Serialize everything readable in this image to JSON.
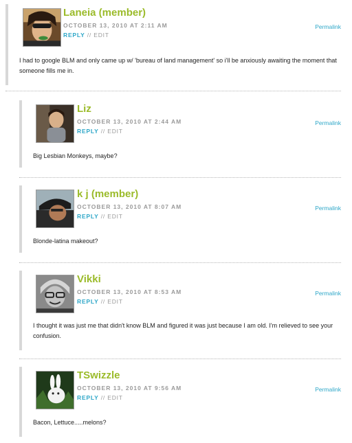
{
  "comments": [
    {
      "author": "Laneia (member)",
      "date": "OCTOBER 13, 2010 AT 2:11 AM",
      "reply": "REPLY",
      "divider": " // ",
      "edit": "EDIT",
      "permalink": "Permalink",
      "text": "I had to google BLM and only came up w/ 'bureau of land management' so i'll be anxiously awaiting the moment that someone fills me in."
    },
    {
      "author": "Liz",
      "date": "OCTOBER 13, 2010 AT 2:44 AM",
      "reply": "REPLY",
      "divider": " // ",
      "edit": "EDIT",
      "permalink": "Permalink",
      "text": "Big Lesbian Monkeys, maybe?"
    },
    {
      "author": "k j (member)",
      "date": "OCTOBER 13, 2010 AT 8:07 AM",
      "reply": "REPLY",
      "divider": " // ",
      "edit": "EDIT",
      "permalink": "Permalink",
      "text": "Blonde-latina makeout?"
    },
    {
      "author": "Vikki",
      "date": "OCTOBER 13, 2010 AT 8:53 AM",
      "reply": "REPLY",
      "divider": " // ",
      "edit": "EDIT",
      "permalink": "Permalink",
      "text": "I thought it was just me that didn't know BLM and figured it was just because I am old. I'm relieved to see your confusion."
    },
    {
      "author": "TSwizzle",
      "date": "OCTOBER 13, 2010 AT 9:56 AM",
      "reply": "REPLY",
      "divider": " // ",
      "edit": "EDIT",
      "permalink": "Permalink",
      "text": "Bacon, Lettuce.....melons?"
    }
  ],
  "colors": {
    "author": "#9bbb2a",
    "link": "#2ea7c8",
    "meta": "#9a9a9a",
    "bar": "#d8d8d8",
    "text": "#222222"
  },
  "icons": [
    "avatar-laneia",
    "avatar-liz",
    "avatar-kj",
    "avatar-vikki",
    "avatar-tswizzle"
  ]
}
